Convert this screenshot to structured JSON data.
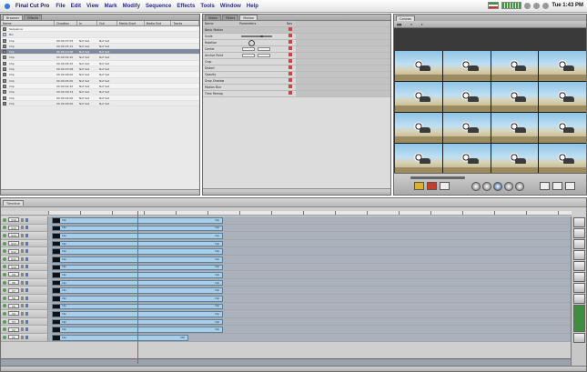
{
  "menubar": {
    "app": "Final Cut Pro",
    "items": [
      "File",
      "Edit",
      "View",
      "Mark",
      "Modify",
      "Sequence",
      "Effects",
      "Tools",
      "Window",
      "Help"
    ],
    "clock": "Tue 1:43 PM"
  },
  "browser": {
    "tabs": [
      "Browser",
      "Effects"
    ],
    "columns": [
      "Name",
      "Duration",
      "In",
      "Out",
      "Media Start",
      "Media End",
      "Tracks"
    ],
    "rows": [
      {
        "name": "Sequence",
        "type": "item",
        "dur": "",
        "in": "",
        "out": ""
      },
      {
        "name": "Bin",
        "type": "folder",
        "dur": "",
        "in": "",
        "out": ""
      },
      {
        "name": "Clip",
        "type": "item",
        "dur": "00:00:07:03",
        "in": "Not Set",
        "out": "Not Set"
      },
      {
        "name": "Clip",
        "type": "item",
        "dur": "00:00:05:12",
        "in": "Not Set",
        "out": "Not Set"
      },
      {
        "name": "Clip",
        "type": "item",
        "dur": "00:00:10:00",
        "in": "Not Set",
        "out": "Not Set",
        "selected": true
      },
      {
        "name": "Clip",
        "type": "item",
        "dur": "00:00:04:20",
        "in": "Not Set",
        "out": "Not Set"
      },
      {
        "name": "Clip",
        "type": "item",
        "dur": "00:00:06:15",
        "in": "Not Set",
        "out": "Not Set"
      },
      {
        "name": "Clip",
        "type": "item",
        "dur": "00:00:03:08",
        "in": "Not Set",
        "out": "Not Set"
      },
      {
        "name": "Clip",
        "type": "item",
        "dur": "00:00:08:00",
        "in": "Not Set",
        "out": "Not Set"
      },
      {
        "name": "Clip",
        "type": "item",
        "dur": "00:00:05:00",
        "in": "Not Set",
        "out": "Not Set"
      },
      {
        "name": "Clip",
        "type": "item",
        "dur": "00:00:02:10",
        "in": "Not Set",
        "out": "Not Set"
      },
      {
        "name": "Clip",
        "type": "item",
        "dur": "00:00:09:14",
        "in": "Not Set",
        "out": "Not Set"
      },
      {
        "name": "Clip",
        "type": "item",
        "dur": "00:00:04:00",
        "in": "Not Set",
        "out": "Not Set"
      },
      {
        "name": "Clip",
        "type": "item",
        "dur": "00:00:06:00",
        "in": "Not Set",
        "out": "Not Set"
      }
    ]
  },
  "viewer": {
    "tabs": [
      "Video",
      "Filters",
      "Motion"
    ],
    "columns": [
      "Name",
      "Parameters",
      "Nav"
    ],
    "rows": [
      {
        "name": "Basic Motion",
        "kind": "head"
      },
      {
        "name": "Scale",
        "kind": "slider",
        "slider": 0.62
      },
      {
        "name": "Rotation",
        "kind": "dial"
      },
      {
        "name": "Center",
        "kind": "values"
      },
      {
        "name": "Anchor Point",
        "kind": "values"
      },
      {
        "name": "Crop",
        "kind": "section"
      },
      {
        "name": "Distort",
        "kind": "section"
      },
      {
        "name": "Opacity",
        "kind": "section"
      },
      {
        "name": "Drop Shadow",
        "kind": "section"
      },
      {
        "name": "Motion Blur",
        "kind": "section"
      },
      {
        "name": "Time Remap",
        "kind": "section"
      }
    ]
  },
  "canvas": {
    "tabs": [
      "Canvas"
    ],
    "tile_count": 16
  },
  "timeline": {
    "tabs": [
      "Timeline"
    ],
    "tracks": [
      {
        "label": "V16",
        "clip": "Clip",
        "clip_right": "Clip"
      },
      {
        "label": "V15",
        "clip": "Clip",
        "clip_right": "Clip"
      },
      {
        "label": "V14",
        "clip": "Clip",
        "clip_right": "Clip"
      },
      {
        "label": "V13",
        "clip": "Clip",
        "clip_right": "Clip"
      },
      {
        "label": "V12",
        "clip": "Clip",
        "clip_right": "Clip"
      },
      {
        "label": "V11",
        "clip": "Clip",
        "clip_right": "Clip"
      },
      {
        "label": "V10",
        "clip": "Clip",
        "clip_right": "Clip"
      },
      {
        "label": "V9",
        "clip": "Clip",
        "clip_right": "Clip"
      },
      {
        "label": "V8",
        "clip": "Clip",
        "clip_right": "Clip"
      },
      {
        "label": "V7",
        "clip": "Clip",
        "clip_right": "Clip"
      },
      {
        "label": "V6",
        "clip": "Clip",
        "clip_right": "Clip"
      },
      {
        "label": "V5",
        "clip": "Clip",
        "clip_right": "Clip"
      },
      {
        "label": "V4",
        "clip": "Clip",
        "clip_right": "Clip"
      },
      {
        "label": "V3",
        "clip": "Clip",
        "clip_right": "Clip"
      },
      {
        "label": "V2",
        "clip": "Clip",
        "clip_right": "Clip"
      },
      {
        "label": "V1",
        "clip": "Clip",
        "clip_right": "Clip",
        "short": true
      }
    ]
  }
}
